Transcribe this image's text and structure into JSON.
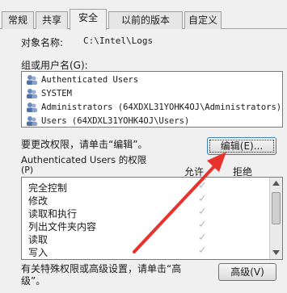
{
  "tabs": [
    "常规",
    "共享",
    "安全",
    "以前的版本",
    "自定义"
  ],
  "object_label": "对象名称:",
  "object_value": "C:\\Intel\\Logs",
  "groups_label": "组或用户名(G):",
  "users": [
    "Authenticated Users",
    "SYSTEM",
    "Administrators (64XDXL31YOHK4OJ\\Administrators)",
    "Users (64XDXL31YOHK4OJ\\Users)"
  ],
  "change_perm_text": "要更改权限，请单击“编辑”。",
  "edit_button": "编辑(E)...",
  "perm_for_label": "Authenticated Users 的权限",
  "perm_p_label": "(P)",
  "allow_header": "允许",
  "deny_header": "拒绝",
  "permissions": [
    "完全控制",
    "修改",
    "读取和执行",
    "列出文件夹内容",
    "读取",
    "写入"
  ],
  "advanced_text": "有关特殊权限或高级设置，请单击“高级”。",
  "advanced_button": "高级(V)",
  "colors": {
    "arrow": "#e8322d",
    "check": "#b8b8b8"
  }
}
